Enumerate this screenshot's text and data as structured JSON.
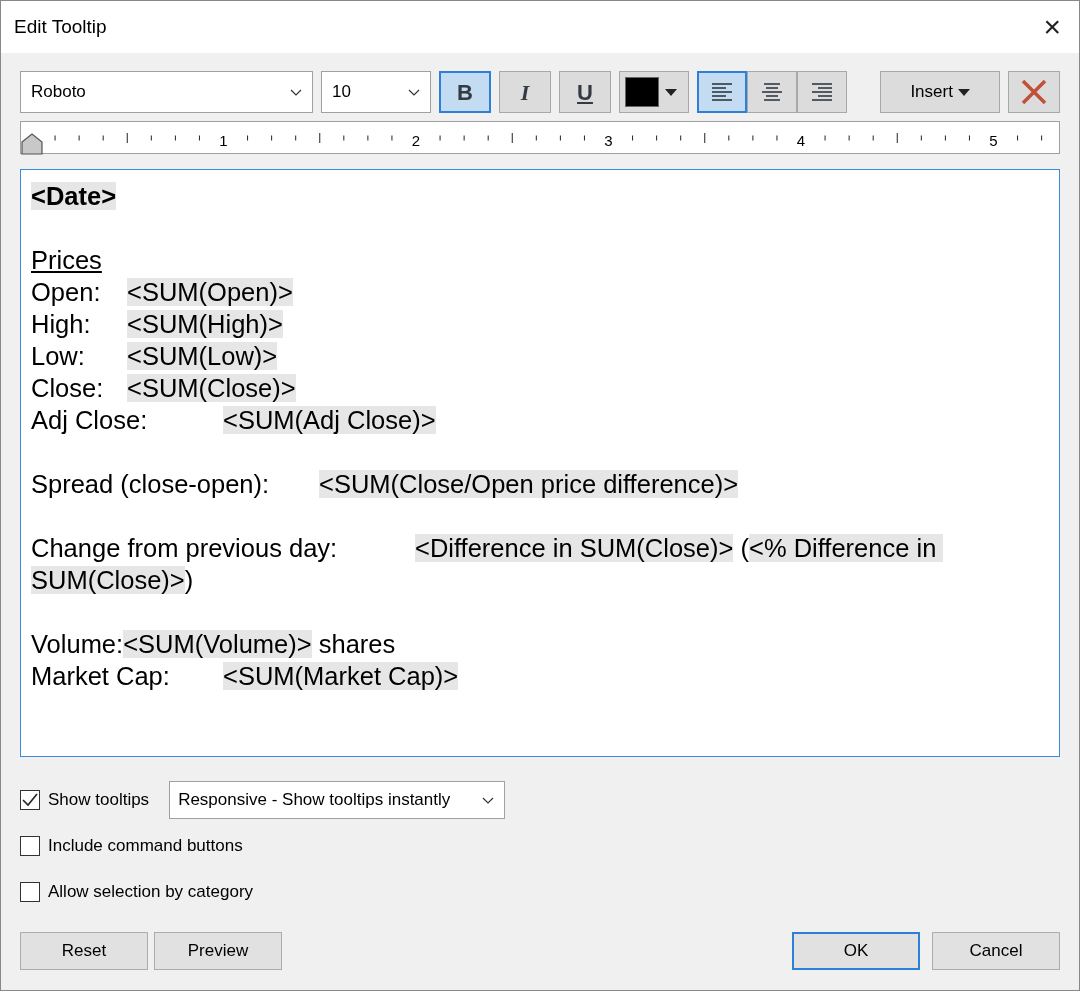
{
  "window": {
    "title": "Edit Tooltip",
    "close": "×"
  },
  "toolbar": {
    "font": "Roboto",
    "size": "10",
    "styles": [
      {
        "kind": "bold",
        "label": "B",
        "selected": true
      },
      {
        "kind": "italic",
        "label": "I",
        "selected": false
      },
      {
        "kind": "underline",
        "label": "U",
        "selected": false
      }
    ],
    "text_color": {
      "color": "#000000"
    },
    "alignment": [
      {
        "kind": "left",
        "selected": true
      },
      {
        "kind": "center",
        "selected": false
      },
      {
        "kind": "right",
        "selected": false
      }
    ],
    "insert": "Insert"
  },
  "ruler": {
    "labels": [
      "1",
      "2",
      "3",
      "4",
      "5"
    ]
  },
  "editor": {
    "lines": [
      {
        "kind": "text",
        "segments": [
          {
            "kind": "bold-field",
            "text": "<Date>"
          }
        ]
      },
      {
        "kind": "blank"
      },
      {
        "kind": "text",
        "segments": [
          {
            "kind": "underline-text",
            "text": "Prices"
          }
        ]
      },
      {
        "kind": "text",
        "segments": [
          {
            "kind": "text",
            "text": "Open:\t"
          },
          {
            "kind": "field",
            "text": "<SUM(Open)>"
          }
        ]
      },
      {
        "kind": "text",
        "segments": [
          {
            "kind": "text",
            "text": "High:\t"
          },
          {
            "kind": "field",
            "text": "<SUM(High)>"
          }
        ]
      },
      {
        "kind": "text",
        "segments": [
          {
            "kind": "text",
            "text": "Low:\t"
          },
          {
            "kind": "field",
            "text": "<SUM(Low)>"
          }
        ]
      },
      {
        "kind": "text",
        "segments": [
          {
            "kind": "text",
            "text": "Close:\t"
          },
          {
            "kind": "field",
            "text": "<SUM(Close)>"
          }
        ]
      },
      {
        "kind": "text",
        "segments": [
          {
            "kind": "text",
            "text": "Adj Close:\t"
          },
          {
            "kind": "field",
            "text": "<SUM(Adj Close)>"
          }
        ]
      },
      {
        "kind": "blank"
      },
      {
        "kind": "text",
        "segments": [
          {
            "kind": "text",
            "text": "Spread (close-open):\t"
          },
          {
            "kind": "field",
            "text": "<SUM(Close/Open price difference)>"
          }
        ]
      },
      {
        "kind": "blank"
      },
      {
        "kind": "text",
        "segments": [
          {
            "kind": "text",
            "text": "Change from previous day:\t"
          },
          {
            "kind": "field",
            "text": "<Difference in SUM(Close)>"
          },
          {
            "kind": "text",
            "text": " ("
          },
          {
            "kind": "field",
            "text": "<% Difference in SUM(Close)>"
          },
          {
            "kind": "text",
            "text": ")"
          }
        ]
      },
      {
        "kind": "blank"
      },
      {
        "kind": "text",
        "segments": [
          {
            "kind": "text",
            "text": "Volume:"
          },
          {
            "kind": "field",
            "text": "<SUM(Volume)>"
          },
          {
            "kind": "text",
            "text": " shares"
          }
        ]
      },
      {
        "kind": "text",
        "segments": [
          {
            "kind": "text",
            "text": "Market Cap:\t"
          },
          {
            "kind": "field",
            "text": "<SUM(Market Cap)>"
          }
        ]
      }
    ]
  },
  "options": [
    {
      "label": "Show tooltips",
      "checked": true,
      "dropdown": "Responsive - Show tooltips instantly"
    },
    {
      "label": "Include command buttons",
      "checked": false
    },
    {
      "label": "Allow selection by category",
      "checked": false
    }
  ],
  "buttons": [
    {
      "label": "Reset",
      "kind": "left",
      "default": false
    },
    {
      "label": "Preview",
      "kind": "left",
      "default": false
    },
    {
      "label": "OK",
      "kind": "right",
      "default": true
    },
    {
      "label": "Cancel",
      "kind": "right",
      "default": false
    }
  ]
}
